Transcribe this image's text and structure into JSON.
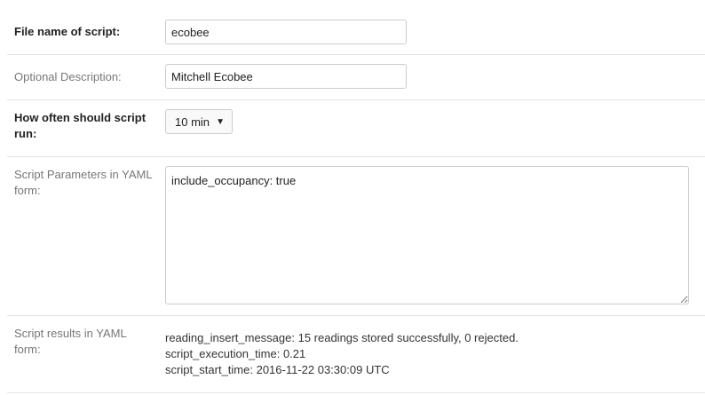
{
  "form": {
    "file_name": {
      "label": "File name of script:",
      "value": "ecobee"
    },
    "description": {
      "label": "Optional Description:",
      "value": "Mitchell Ecobee"
    },
    "frequency": {
      "label_line1": "How often should script",
      "label_line2": "run:",
      "selected": "10 min",
      "caret_icon": "▼"
    },
    "parameters": {
      "label_line1": "Script Parameters in YAML",
      "label_line2": "form:",
      "value": "include_occupancy: true"
    },
    "results": {
      "label_line1": "Script results in YAML",
      "label_line2": "form:",
      "lines": [
        "reading_insert_message: 15 readings stored successfully, 0 rejected.",
        "script_execution_time: 0.21",
        "script_start_time: 2016-11-22 03:30:09 UTC"
      ]
    }
  }
}
